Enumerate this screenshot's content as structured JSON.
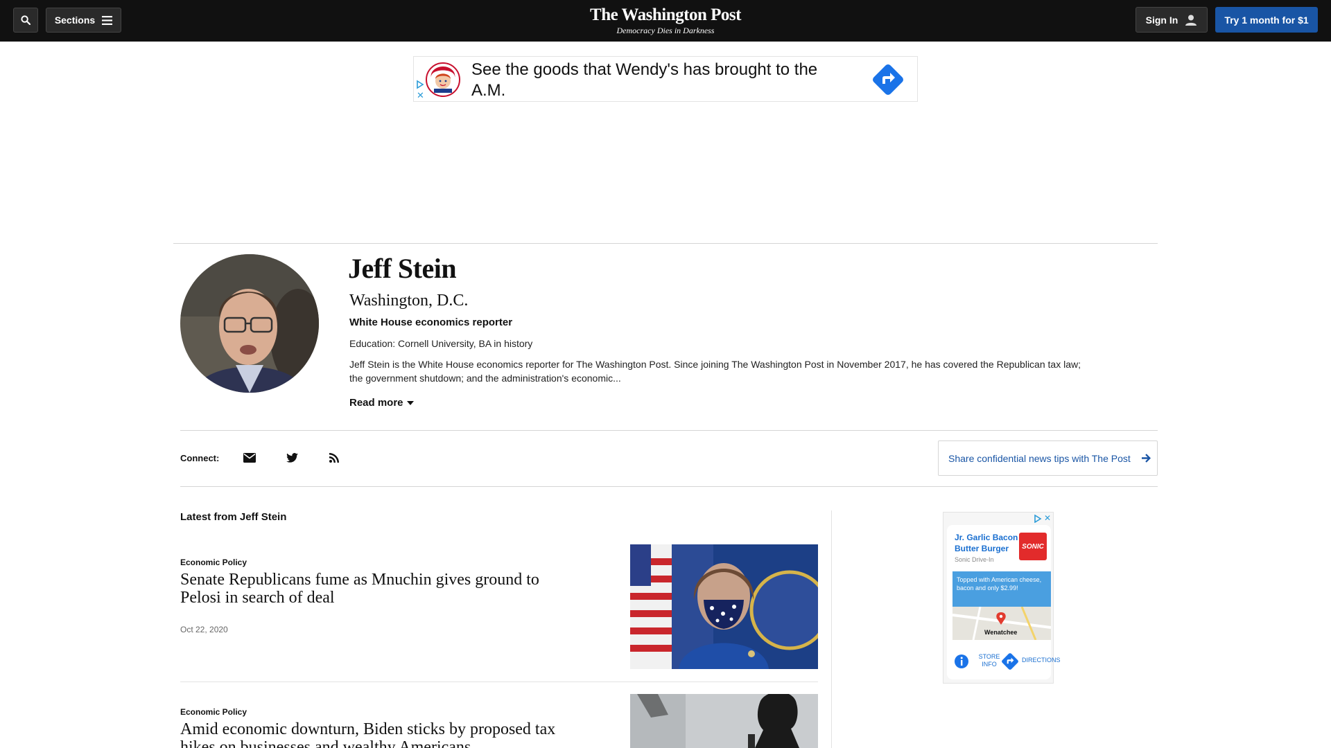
{
  "header": {
    "sections_label": "Sections",
    "logo": "The Washington Post",
    "tagline": "Democracy Dies in Darkness",
    "signin_label": "Sign In",
    "subscribe_label": "Try 1 month for $1"
  },
  "top_ad": {
    "text": "See the goods that Wendy's has brought to the A.M.",
    "close_glyph": "✕"
  },
  "author": {
    "name": "Jeff Stein",
    "location": "Washington, D.C.",
    "role": "White House economics reporter",
    "education": "Education: Cornell University, BA in history",
    "bio": "Jeff Stein is the White House economics reporter for The Washington Post. Since joining The Washington Post in November 2017, he has covered the Republican tax law; the government shutdown; and the administration's economic...",
    "read_more": "Read more"
  },
  "connect": {
    "label": "Connect:",
    "icons": [
      "email-icon",
      "twitter-icon",
      "rss-icon"
    ],
    "tips_label": "Share confidential news tips with The Post"
  },
  "latest": {
    "heading": "Latest from Jeff Stein",
    "stories": [
      {
        "kicker": "Economic Policy",
        "headline": "Senate Republicans fume as Mnuchin gives ground to Pelosi in search of deal",
        "date": "Oct 22, 2020"
      },
      {
        "kicker": "Economic Policy",
        "headline": "Amid economic downturn, Biden sticks by proposed tax hikes on businesses and wealthy Americans",
        "date": ""
      }
    ]
  },
  "side_ad": {
    "title": "Jr. Garlic Bacon Butter Burger",
    "brand": "Sonic Drive-In",
    "logo_text": "SONIC",
    "promo": "Topped with American cheese, bacon and only $2.99!",
    "map_label": "Wenatchee",
    "store_info": "STORE INFO",
    "directions": "DIRECTIONS",
    "close_glyph": "✕"
  },
  "colors": {
    "header_bg": "#111111",
    "accent_blue": "#1955a5",
    "ad_blue": "#1a6fd0"
  }
}
